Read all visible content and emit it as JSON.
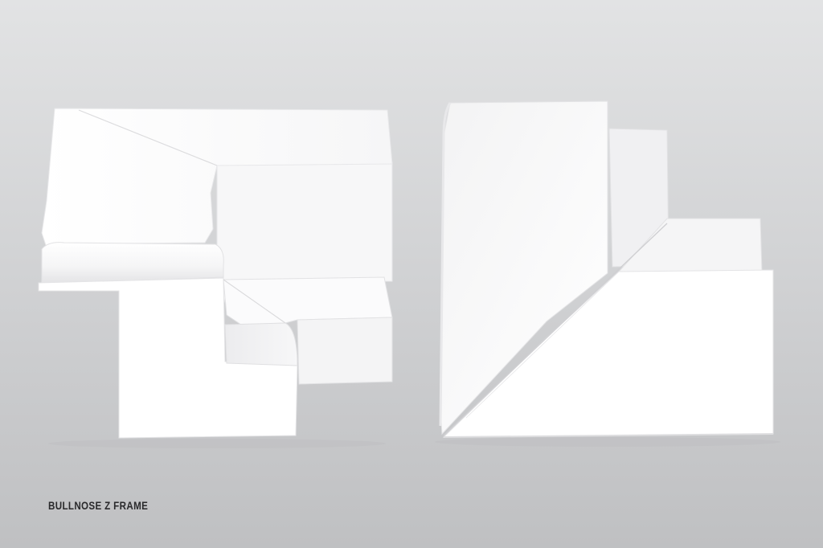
{
  "caption": "BULLNOSE Z FRAME",
  "colors": {
    "background_top": "#e2e3e4",
    "background_bottom": "#bfc0c2",
    "product": "#ffffff",
    "caption_text": "#2a2a2c"
  },
  "scene": {
    "subject": "two white frame corner pieces",
    "views": [
      "left-piece",
      "right-piece"
    ]
  }
}
